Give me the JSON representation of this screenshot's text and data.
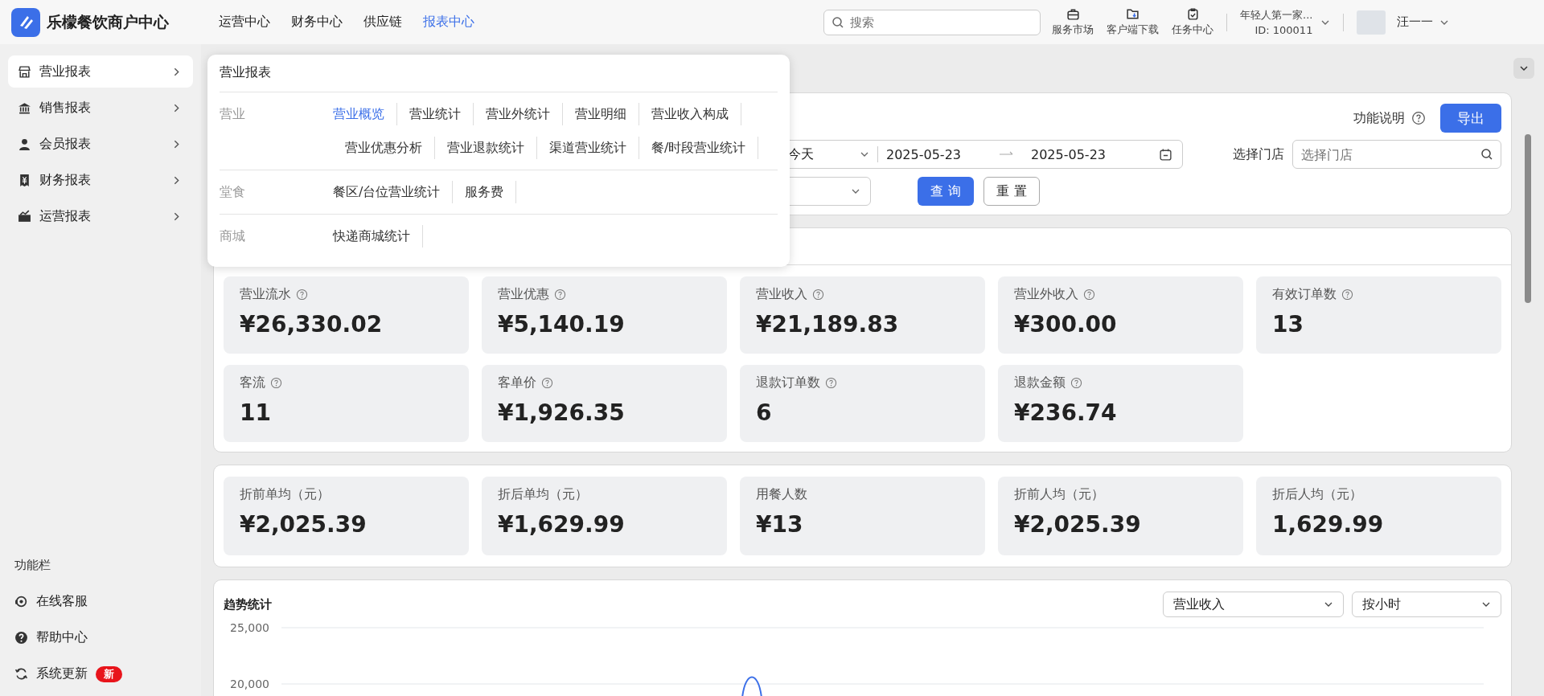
{
  "header": {
    "logo_text": "乐檬餐饮商户中心",
    "nav": [
      {
        "label": "运营中心",
        "selected": false
      },
      {
        "label": "财务中心",
        "selected": false
      },
      {
        "label": "供应链",
        "selected": false
      },
      {
        "label": "报表中心",
        "selected": true
      }
    ],
    "search": {
      "placeholder": "搜索"
    },
    "tools": [
      {
        "label": "服务市场"
      },
      {
        "label": "客户端下载"
      },
      {
        "label": "任务中心"
      }
    ],
    "account": {
      "name": "年轻人第一家...",
      "id": "ID: 100011"
    },
    "user": {
      "name": "汪一一"
    }
  },
  "sidebar": {
    "items": [
      {
        "label": "营业报表",
        "selected": true
      },
      {
        "label": "销售报表",
        "selected": false
      },
      {
        "label": "会员报表",
        "selected": false
      },
      {
        "label": "财务报表",
        "selected": false
      },
      {
        "label": "运营报表",
        "selected": false
      }
    ],
    "footer_title": "功能栏",
    "footer_items": [
      {
        "label": "在线客服"
      },
      {
        "label": "帮助中心"
      },
      {
        "label": "系统更新",
        "badge": "新"
      }
    ]
  },
  "menu": {
    "title": "营业报表",
    "groups": [
      {
        "label": "营业",
        "links": [
          {
            "label": "营业概览",
            "selected": true
          },
          {
            "label": "营业统计",
            "selected": false
          },
          {
            "label": "营业外统计",
            "selected": false
          },
          {
            "label": "营业明细",
            "selected": false
          },
          {
            "label": "营业收入构成",
            "selected": false
          },
          {
            "label": "营业优惠分析",
            "selected": false
          },
          {
            "label": "营业退款统计",
            "selected": false
          },
          {
            "label": "渠道营业统计",
            "selected": false
          },
          {
            "label": "餐/时段营业统计",
            "selected": false
          }
        ]
      },
      {
        "label": "堂食",
        "links": [
          {
            "label": "餐区/台位营业统计",
            "selected": false
          },
          {
            "label": "服务费",
            "selected": false
          }
        ]
      },
      {
        "label": "商城",
        "links": [
          {
            "label": "快递商城统计",
            "selected": false
          }
        ]
      }
    ]
  },
  "filter": {
    "help_label": "功能说明",
    "export_button": "导出",
    "date_preset": "今天",
    "date_start": "2025-05-23",
    "date_end": "2025-05-23",
    "store_label": "选择门店",
    "store_placeholder": "选择门店",
    "query_button": "查 询",
    "reset_button": "重 置"
  },
  "summary_tiles": [
    {
      "label": "营业流水",
      "value": "¥26,330.02",
      "help": true
    },
    {
      "label": "营业优惠",
      "value": "¥5,140.19",
      "help": true
    },
    {
      "label": "营业收入",
      "value": "¥21,189.83",
      "help": true
    },
    {
      "label": "营业外收入",
      "value": "¥300.00",
      "help": true
    },
    {
      "label": "有效订单数",
      "value": "13",
      "help": true
    },
    {
      "label": "客流",
      "value": "11",
      "help": true
    },
    {
      "label": "客单价",
      "value": "¥1,926.35",
      "help": true
    },
    {
      "label": "退款订单数",
      "value": "6",
      "help": true
    },
    {
      "label": "退款金额",
      "value": "¥236.74",
      "help": true
    }
  ],
  "average_tiles": [
    {
      "label": "折前单均（元）",
      "value": "¥2,025.39"
    },
    {
      "label": "折后单均（元）",
      "value": "¥1,629.99"
    },
    {
      "label": "用餐人数",
      "value": "¥13"
    },
    {
      "label": "折前人均（元）",
      "value": "¥2,025.39"
    },
    {
      "label": "折后人均（元）",
      "value": "1,629.99"
    }
  ],
  "trend": {
    "title": "趋势统计",
    "metric": "营业收入",
    "granularity": "按小时",
    "axis_labels": [
      "25,000",
      "20,000"
    ]
  }
}
